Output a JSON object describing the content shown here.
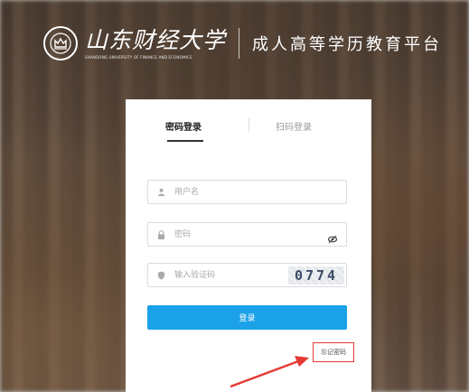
{
  "header": {
    "university_cn": "山东财经大学",
    "university_en": "SHANDONG UNIVERSITY OF FINANCE AND ECONOMICS",
    "platform_title": "成人高等学历教育平台",
    "emblem_icon": "university-emblem-icon"
  },
  "login": {
    "tab_password": "密码登录",
    "tab_scan": "扫码登录",
    "username_placeholder": "用户名",
    "password_placeholder": "密码",
    "captcha_placeholder": "输入验证码",
    "captcha_code": "0774",
    "login_button": "登录",
    "remember_password": "忘记密码"
  },
  "colors": {
    "accent": "#1aa1e8",
    "highlight": "#e53935"
  },
  "icons": [
    "user-icon",
    "lock-icon",
    "eye-icon",
    "shield-icon"
  ]
}
